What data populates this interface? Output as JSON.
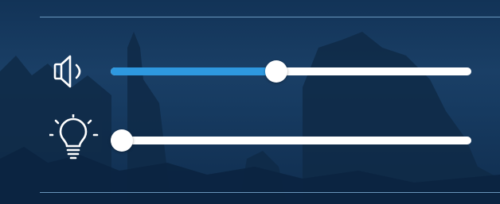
{
  "controls": {
    "volume": {
      "icon": "speaker-icon",
      "level": 0.46,
      "fill_color": "#2e98df"
    },
    "brightness": {
      "icon": "lightbulb-icon",
      "level": 0.03
    }
  },
  "colors": {
    "track": "#ffffff",
    "thumb": "#ffffff",
    "divider": "#7fb0d8"
  }
}
